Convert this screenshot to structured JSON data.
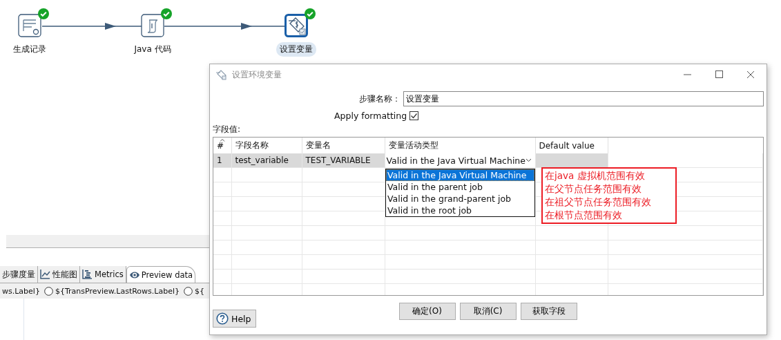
{
  "canvas": {
    "nodes": [
      {
        "label": "生成记录",
        "kind": "generator",
        "ok": true,
        "selected": false
      },
      {
        "label": "Java 代码",
        "kind": "script",
        "ok": true,
        "selected": false
      },
      {
        "label": "设置变量",
        "kind": "variable",
        "ok": true,
        "selected": true
      }
    ]
  },
  "bottom_panel": {
    "tabs": [
      {
        "label": "步骤度量",
        "kind": "plain",
        "selected": false
      },
      {
        "label": "性能图",
        "kind": "chart",
        "selected": false
      },
      {
        "label": "Metrics",
        "kind": "metrics",
        "selected": false
      },
      {
        "label": "Preview data",
        "kind": "eye",
        "selected": true
      }
    ],
    "radios": [
      {
        "label": "ws.Label}",
        "kind": "text"
      },
      {
        "label": "${TransPreview.LastRows.Label}",
        "kind": "radio",
        "checked": false
      },
      {
        "label": "${",
        "kind": "radio",
        "checked": false
      }
    ]
  },
  "dialog": {
    "title": "设置环境变量",
    "step_name": {
      "label": "步骤名称：",
      "value": "设置变量"
    },
    "apply_formatting": {
      "label": "Apply formatting",
      "checked": true
    },
    "fields_label": "字段值:",
    "table": {
      "columns": [
        "#",
        "字段名称",
        "变量名",
        "变量活动类型",
        "Default value"
      ],
      "rows": [
        {
          "number": "1",
          "field_name": "test_variable",
          "variable_name": "TEST_VARIABLE",
          "scope": "Valid in the Java Virtual Machine",
          "selected": true
        }
      ]
    },
    "dropdown": {
      "options": [
        {
          "label": "Valid in the Java Virtual Machine",
          "selected": true
        },
        {
          "label": "Valid in the parent job",
          "selected": false
        },
        {
          "label": "Valid in the grand-parent job",
          "selected": false
        },
        {
          "label": "Valid in the root job",
          "selected": false
        }
      ]
    },
    "annotation": [
      "在java 虚拟机范围有效",
      "在父节点任务范围有效",
      "在祖父节点任务范围有效",
      "在根节点范围有效"
    ],
    "buttons": [
      "确定(O)",
      "取消(C)",
      "获取字段"
    ],
    "help": "Help"
  }
}
